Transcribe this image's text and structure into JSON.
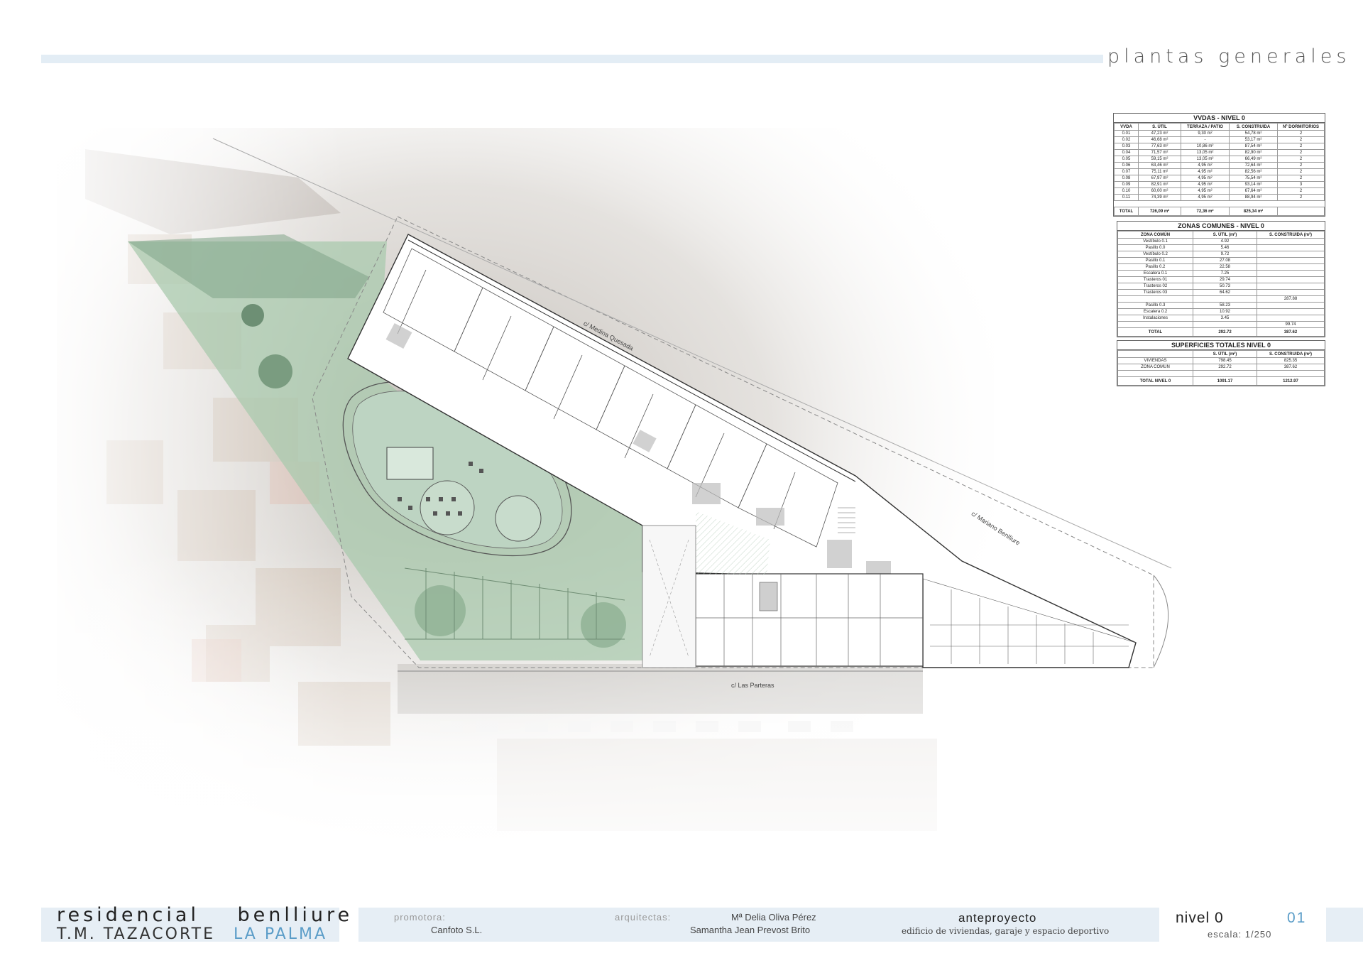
{
  "header": {
    "sheet_title": "plantas generales"
  },
  "plan": {
    "street_labels": [
      "c/ Medina Quesada",
      "c/ Mariano Benlliure",
      "c/ Las Parteras"
    ]
  },
  "table_viviendas": {
    "title": "VVDAS - NIVEL 0",
    "headers": [
      "VVDA",
      "S. ÚTIL",
      "TERRAZA / PATIO",
      "S. CONSTRUIDA",
      "Nº DORMITORIOS"
    ],
    "rows": [
      [
        "0.01",
        "47,23 m²",
        "9,30 m²",
        "54,78 m²",
        "2"
      ],
      [
        "0.02",
        "46,68 m²",
        "-",
        "53,17 m²",
        "2"
      ],
      [
        "0.03",
        "77,63 m²",
        "10,86 m²",
        "87,54 m²",
        "2"
      ],
      [
        "0.04",
        "71,57 m²",
        "13,05 m²",
        "82,90 m²",
        "2"
      ],
      [
        "0.05",
        "59,15 m²",
        "13,05 m²",
        "66,49 m²",
        "2"
      ],
      [
        "0.06",
        "63,46 m²",
        "4,95 m²",
        "72,64 m²",
        "2"
      ],
      [
        "0.07",
        "75,11 m²",
        "4,95 m²",
        "82,56 m²",
        "2"
      ],
      [
        "0.08",
        "67,97 m²",
        "4,95 m²",
        "75,54 m²",
        "2"
      ],
      [
        "0.09",
        "82,91 m²",
        "4,95 m²",
        "93,14 m²",
        "3"
      ],
      [
        "0.10",
        "60,00 m²",
        "4,95 m²",
        "67,64 m²",
        "2"
      ],
      [
        "0.11",
        "74,39 m²",
        "4,95 m²",
        "88,94 m²",
        "2"
      ]
    ],
    "total": [
      "TOTAL",
      "726,09 m²",
      "72,36 m²",
      "825,34 m²",
      ""
    ]
  },
  "table_comunes": {
    "title": "ZONAS COMUNES - NIVEL 0",
    "headers": [
      "ZONA COMÚN",
      "S. ÚTIL (m²)",
      "S. CONSTRUIDA (m²)"
    ],
    "rows": [
      [
        "Vestíbulo 0.1",
        "4.92",
        ""
      ],
      [
        "Pasillo 0.0",
        "5.46",
        ""
      ],
      [
        "Vestíbulo 0.2",
        "9.72",
        ""
      ],
      [
        "Pasillo 0.1",
        "27.08",
        ""
      ],
      [
        "Pasillo 0.2",
        "22.58",
        ""
      ],
      [
        "Escalera 0.1",
        "7.25",
        ""
      ],
      [
        "Trasteros 01",
        "29.74",
        ""
      ],
      [
        "Trasteros 02",
        "50.73",
        ""
      ],
      [
        "Trasteros 03",
        "64.62",
        ""
      ],
      [
        "",
        "",
        "287.88"
      ],
      [
        "Pasillo 0.3",
        "58.23",
        ""
      ],
      [
        "Escalera 0.2",
        "10.92",
        ""
      ],
      [
        "Instalaciones",
        "3.45",
        ""
      ],
      [
        "",
        "",
        "99.74"
      ]
    ],
    "total": [
      "TOTAL",
      "292.72",
      "387.62"
    ]
  },
  "table_totales": {
    "title": "SUPERFICIES TOTALES NIVEL 0",
    "headers": [
      "",
      "S. ÚTIL (m²)",
      "S. CONSTRUIDA (m²)"
    ],
    "rows": [
      [
        "VIVIENDAS",
        "798.45",
        "825.35"
      ],
      [
        "ZONA COMÚN",
        "292.72",
        "387.62"
      ],
      [
        "",
        "",
        ""
      ]
    ],
    "total": [
      "TOTAL NIVEL 0",
      "1091.17",
      "1212.97"
    ]
  },
  "footer": {
    "project_name": "residencial benlliure",
    "municipality": "T.M. TAZACORTE",
    "island": "LA PALMA",
    "promoter_label": "promotora:",
    "promoter": "Canfoto S.L.",
    "architects_label": "arquitectas:",
    "architect_1": "Mª Delia Oliva Pérez",
    "architect_2": "Samantha Jean Prevost Brito",
    "phase": "anteproyecto",
    "description": "edificio de viviendas, garaje y espacio deportivo",
    "level": "nivel 0",
    "sheet_number": "01",
    "scale": "escala: 1/250"
  },
  "colors": {
    "accent_blue": "#5b9dc8",
    "band": "#e6eef5",
    "landscape_green": "#a9c9ad"
  }
}
